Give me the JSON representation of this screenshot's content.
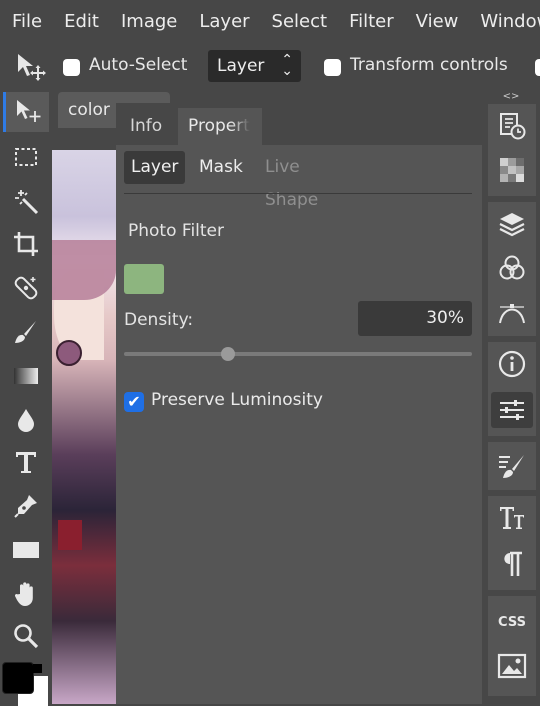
{
  "menubar": {
    "items": [
      "File",
      "Edit",
      "Image",
      "Layer",
      "Select",
      "Filter",
      "View",
      "Window"
    ]
  },
  "options": {
    "auto_select_label": "Auto-Select",
    "layer_select_value": "Layer",
    "transform_label": "Transform controls"
  },
  "document": {
    "tab_title": "color"
  },
  "panel": {
    "tabs": {
      "info": "Info",
      "properties": "Propert"
    },
    "subtabs": {
      "layer": "Layer",
      "mask": "Mask",
      "live_shape": "Live Shape"
    },
    "adjustment_title": "Photo Filter",
    "filter_color": "#8db57f",
    "density_label": "Density:",
    "density_value": "30%",
    "density_percent": 30,
    "preserve_luminosity_label": "Preserve Luminosity",
    "preserve_luminosity_checked": true
  },
  "colors": {
    "accent": "#1f6fe5",
    "foreground": "#000000",
    "background": "#ffffff"
  },
  "tools": [
    "move",
    "marquee",
    "magic-wand",
    "crop",
    "healing",
    "brush",
    "gradient",
    "blur",
    "text",
    "pen",
    "rectangle",
    "hand",
    "zoom"
  ],
  "right_panels": [
    "history",
    "swatches",
    "layers",
    "channels",
    "paths",
    "info",
    "adjustments",
    "brush",
    "character",
    "paragraph",
    "css",
    "image"
  ]
}
